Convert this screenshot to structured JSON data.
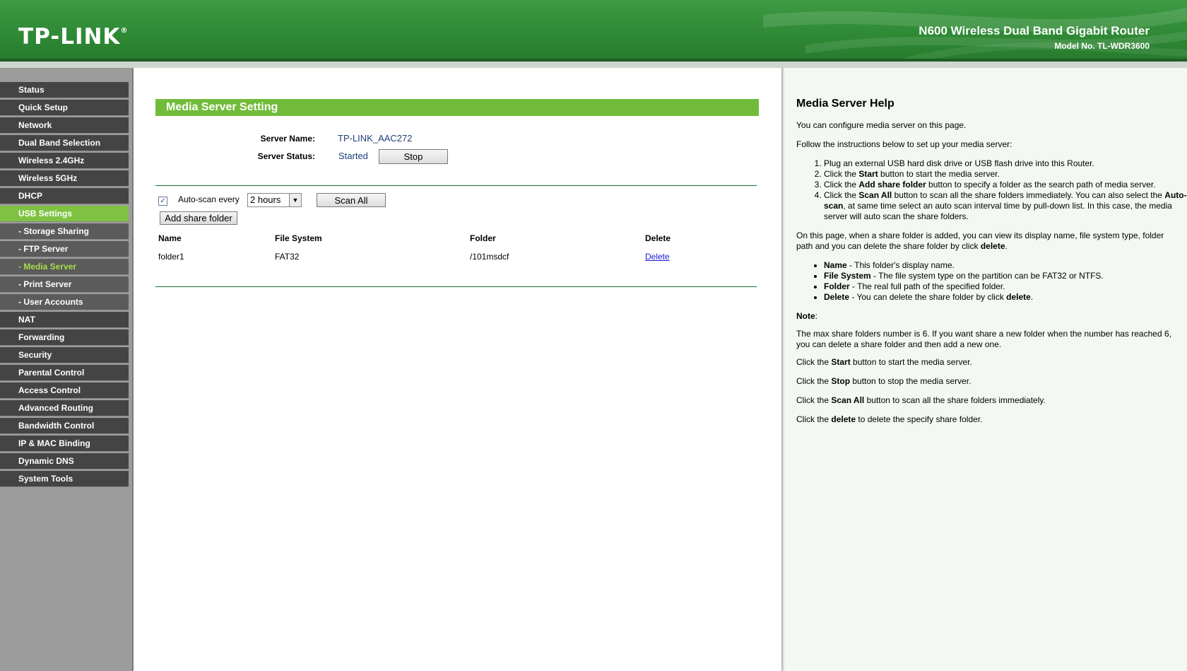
{
  "header": {
    "logo": "TP-LINK",
    "logo_mark": "®",
    "product_title": "N600 Wireless Dual Band Gigabit Router",
    "model_no": "Model No. TL-WDR3600"
  },
  "sidebar": {
    "items": [
      {
        "label": "Status"
      },
      {
        "label": "Quick Setup"
      },
      {
        "label": "Network"
      },
      {
        "label": "Dual Band Selection"
      },
      {
        "label": "Wireless 2.4GHz"
      },
      {
        "label": "Wireless 5GHz"
      },
      {
        "label": "DHCP"
      },
      {
        "label": "USB Settings"
      },
      {
        "label": "- Storage Sharing"
      },
      {
        "label": "- FTP Server"
      },
      {
        "label": "- Media Server"
      },
      {
        "label": "- Print Server"
      },
      {
        "label": "- User Accounts"
      },
      {
        "label": "NAT"
      },
      {
        "label": "Forwarding"
      },
      {
        "label": "Security"
      },
      {
        "label": "Parental Control"
      },
      {
        "label": "Access Control"
      },
      {
        "label": "Advanced Routing"
      },
      {
        "label": "Bandwidth Control"
      },
      {
        "label": "IP & MAC Binding"
      },
      {
        "label": "Dynamic DNS"
      },
      {
        "label": "System Tools"
      }
    ]
  },
  "main": {
    "title": "Media Server Setting",
    "server_name_label": "Server Name:",
    "server_name": "TP-LINK_AAC272",
    "server_status_label": "Server Status:",
    "server_status": "Started",
    "stop_button": "Stop",
    "autoscan_label": "Auto-scan every",
    "autoscan_checked": "✓",
    "interval": "2 hours",
    "scan_all_button": "Scan All",
    "add_share_button": "Add share folder",
    "table": {
      "headers": [
        "Name",
        "File System",
        "Folder",
        "Delete"
      ],
      "rows": [
        {
          "name": "folder1",
          "fs": "FAT32",
          "folder": "/101msdcf",
          "delete": "Delete"
        }
      ]
    }
  },
  "help": {
    "title": "Media Server Help",
    "intro": "You can configure media server on this page.",
    "follow": "Follow the instructions below to set up your media server:",
    "steps": {
      "s1": "Plug an external USB hard disk drive or USB flash drive into this Router.",
      "s2a": "Click the ",
      "s2b": "Start",
      "s2c": " button to start the media server.",
      "s3a": "Click the ",
      "s3b": "Add share folder",
      "s3c": " button to specify a folder as the search path of media server.",
      "s4a": "Click the ",
      "s4b": "Scan All",
      "s4c": " button to scan all the share folders immediately. You can also select the ",
      "s4d": "Auto-scan",
      "s4e": ", at same time select an auto scan interval time by pull-down list. In this case, the media server will auto scan the share folders."
    },
    "page_a": "On this page, when a share folder is added, you can view its display name, file system type, folder path and you can delete the share folder by click ",
    "page_b": "delete",
    "page_c": ".",
    "bullets": {
      "b1a": "Name",
      "b1b": " - This folder's display name.",
      "b2a": "File System",
      "b2b": " - The file system type on the partition can be FAT32 or NTFS.",
      "b3a": "Folder",
      "b3b": " - The real full path of the specified folder.",
      "b4a": "Delete",
      "b4b": " - You can delete the share folder by click ",
      "b4c": "delete",
      "b4d": "."
    },
    "note": "Note",
    "note_colon": ":",
    "max_note": "The max share folders number is 6. If you want share a new folder when the number has reached 6, you can delete a share folder and then add a new one.",
    "start_a": "Click the ",
    "start_b": "Start",
    "start_c": " button to start the media server.",
    "stop_a": "Click the ",
    "stop_b": "Stop",
    "stop_c": " button to stop the media server.",
    "scan_a": "Click the ",
    "scan_b": "Scan All",
    "scan_c": " button to scan all the share folders immediately.",
    "del_a": "Click the ",
    "del_b": "delete",
    "del_c": " to delete the specify share folder."
  },
  "colors": {
    "header_green": "#2f8a35",
    "title_green": "#71bb3a",
    "active_menu": "#7fc241",
    "menu_bg": "#444444",
    "link": "#1a1ad4"
  }
}
